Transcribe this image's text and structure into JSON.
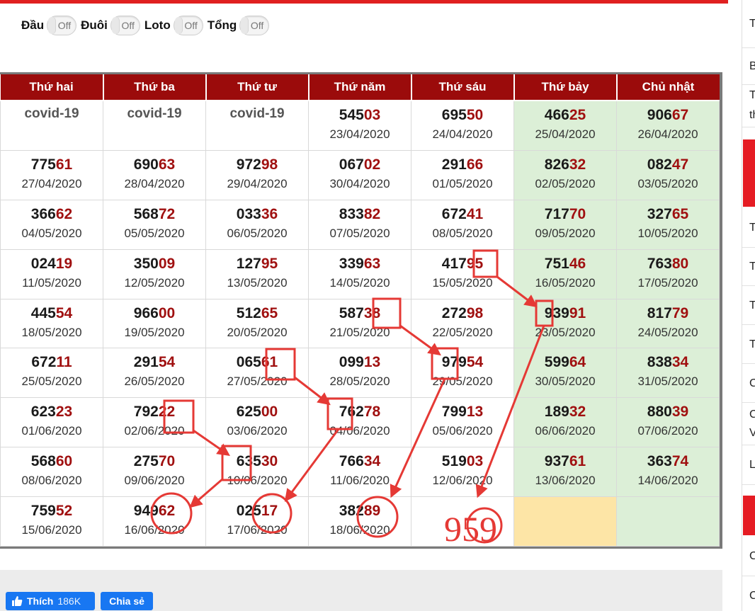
{
  "toggles": [
    {
      "label": "Đầu",
      "state": "Off"
    },
    {
      "label": "Đuôi",
      "state": "Off"
    },
    {
      "label": "Loto",
      "state": "Off"
    },
    {
      "label": "Tổng",
      "state": "Off"
    }
  ],
  "days": [
    "Thứ hai",
    "Thứ ba",
    "Thứ tư",
    "Thứ năm",
    "Thứ sáu",
    "Thứ bảy",
    "Chủ nhật"
  ],
  "rows": [
    [
      {
        "covid": "covid-19"
      },
      {
        "covid": "covid-19"
      },
      {
        "covid": "covid-19"
      },
      {
        "prefix": "545",
        "tail": "03",
        "date": "23/04/2020"
      },
      {
        "prefix": "695",
        "tail": "50",
        "date": "24/04/2020"
      },
      {
        "prefix": "466",
        "tail": "25",
        "date": "25/04/2020"
      },
      {
        "prefix": "906",
        "tail": "67",
        "date": "26/04/2020"
      }
    ],
    [
      {
        "prefix": "775",
        "tail": "61",
        "date": "27/04/2020"
      },
      {
        "prefix": "690",
        "tail": "63",
        "date": "28/04/2020"
      },
      {
        "prefix": "972",
        "tail": "98",
        "date": "29/04/2020"
      },
      {
        "prefix": "067",
        "tail": "02",
        "date": "30/04/2020"
      },
      {
        "prefix": "291",
        "tail": "66",
        "date": "01/05/2020"
      },
      {
        "prefix": "826",
        "tail": "32",
        "date": "02/05/2020"
      },
      {
        "prefix": "082",
        "tail": "47",
        "date": "03/05/2020"
      }
    ],
    [
      {
        "prefix": "366",
        "tail": "62",
        "date": "04/05/2020"
      },
      {
        "prefix": "568",
        "tail": "72",
        "date": "05/05/2020"
      },
      {
        "prefix": "033",
        "tail": "36",
        "date": "06/05/2020"
      },
      {
        "prefix": "833",
        "tail": "82",
        "date": "07/05/2020"
      },
      {
        "prefix": "672",
        "tail": "41",
        "date": "08/05/2020"
      },
      {
        "prefix": "717",
        "tail": "70",
        "date": "09/05/2020"
      },
      {
        "prefix": "327",
        "tail": "65",
        "date": "10/05/2020"
      }
    ],
    [
      {
        "prefix": "024",
        "tail": "19",
        "date": "11/05/2020"
      },
      {
        "prefix": "350",
        "tail": "09",
        "date": "12/05/2020"
      },
      {
        "prefix": "127",
        "tail": "95",
        "date": "13/05/2020"
      },
      {
        "prefix": "339",
        "tail": "63",
        "date": "14/05/2020"
      },
      {
        "prefix": "417",
        "tail": "95",
        "date": "15/05/2020"
      },
      {
        "prefix": "751",
        "tail": "46",
        "date": "16/05/2020"
      },
      {
        "prefix": "763",
        "tail": "80",
        "date": "17/05/2020"
      }
    ],
    [
      {
        "prefix": "445",
        "tail": "54",
        "date": "18/05/2020"
      },
      {
        "prefix": "966",
        "tail": "00",
        "date": "19/05/2020"
      },
      {
        "prefix": "512",
        "tail": "65",
        "date": "20/05/2020"
      },
      {
        "prefix": "587",
        "tail": "38",
        "date": "21/05/2020"
      },
      {
        "prefix": "272",
        "tail": "98",
        "date": "22/05/2020"
      },
      {
        "prefix": "939",
        "tail": "91",
        "date": "23/05/2020"
      },
      {
        "prefix": "817",
        "tail": "79",
        "date": "24/05/2020"
      }
    ],
    [
      {
        "prefix": "672",
        "tail": "11",
        "date": "25/05/2020"
      },
      {
        "prefix": "291",
        "tail": "54",
        "date": "26/05/2020"
      },
      {
        "prefix": "065",
        "tail": "61",
        "date": "27/05/2020"
      },
      {
        "prefix": "099",
        "tail": "13",
        "date": "28/05/2020"
      },
      {
        "prefix": "979",
        "tail": "54",
        "date": "29/05/2020"
      },
      {
        "prefix": "599",
        "tail": "64",
        "date": "30/05/2020"
      },
      {
        "prefix": "838",
        "tail": "34",
        "date": "31/05/2020"
      }
    ],
    [
      {
        "prefix": "623",
        "tail": "23",
        "date": "01/06/2020"
      },
      {
        "prefix": "792",
        "tail": "22",
        "date": "02/06/2020"
      },
      {
        "prefix": "625",
        "tail": "00",
        "date": "03/06/2020"
      },
      {
        "prefix": "762",
        "tail": "78",
        "date": "04/06/2020"
      },
      {
        "prefix": "799",
        "tail": "13",
        "date": "05/06/2020"
      },
      {
        "prefix": "189",
        "tail": "32",
        "date": "06/06/2020"
      },
      {
        "prefix": "880",
        "tail": "39",
        "date": "07/06/2020"
      }
    ],
    [
      {
        "prefix": "568",
        "tail": "60",
        "date": "08/06/2020"
      },
      {
        "prefix": "275",
        "tail": "70",
        "date": "09/06/2020"
      },
      {
        "prefix": "635",
        "tail": "30",
        "date": "10/06/2020"
      },
      {
        "prefix": "766",
        "tail": "34",
        "date": "11/06/2020"
      },
      {
        "prefix": "519",
        "tail": "03",
        "date": "12/06/2020"
      },
      {
        "prefix": "937",
        "tail": "61",
        "date": "13/06/2020"
      },
      {
        "prefix": "363",
        "tail": "74",
        "date": "14/06/2020"
      }
    ],
    [
      {
        "prefix": "759",
        "tail": "52",
        "date": "15/06/2020"
      },
      {
        "prefix": "949",
        "tail": "62",
        "date": "16/06/2020"
      },
      {
        "prefix": "025",
        "tail": "17",
        "date": "17/06/2020"
      },
      {
        "prefix": "382",
        "tail": "89",
        "date": "18/06/2020"
      },
      {
        "empty": true
      },
      {
        "today": true
      },
      {
        "empty": true
      }
    ]
  ],
  "annotation": {
    "text": "959",
    "color": "#e53935"
  },
  "footer": {
    "like_label": "Thích",
    "like_count": "186K",
    "share_label": "Chia sẻ",
    "button_color": "#1877f2"
  },
  "sidebar": {
    "items": [
      "T",
      "B",
      "T",
      "th",
      "T",
      "T",
      "T",
      "T",
      "C",
      "C",
      "V",
      "L",
      "C",
      "C"
    ]
  },
  "colors": {
    "header_bg": "#9b0b0b",
    "weekend_bg": "#dcefd7",
    "today_bg": "#fde5a6",
    "tail": "#a01010",
    "accent": "#e02020"
  }
}
